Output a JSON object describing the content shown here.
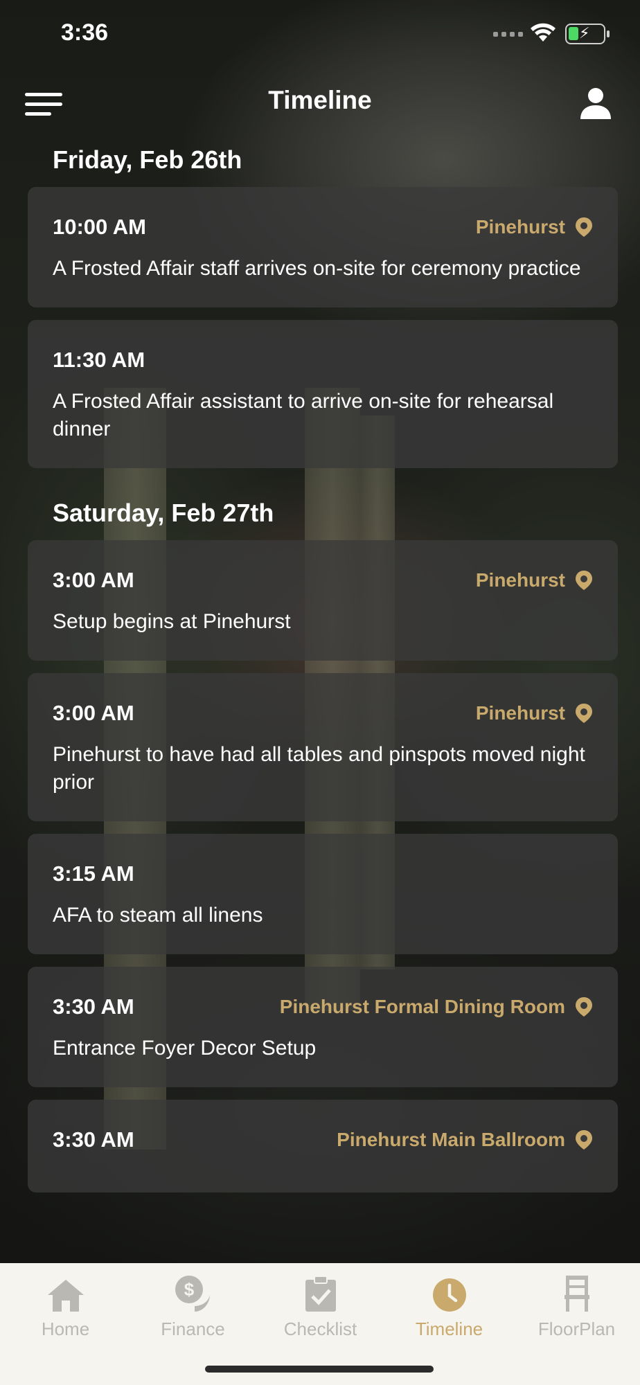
{
  "status_bar": {
    "time": "3:36"
  },
  "header": {
    "title": "Timeline"
  },
  "timeline": [
    {
      "day": "Friday, Feb 26th",
      "events": [
        {
          "time": "10:00 AM",
          "location": "Pinehurst",
          "description": "A Frosted Affair staff arrives on-site for ceremony practice"
        },
        {
          "time": "11:30 AM",
          "location": "",
          "description": "A Frosted Affair assistant to arrive on-site for rehearsal dinner"
        }
      ]
    },
    {
      "day": "Saturday, Feb 27th",
      "events": [
        {
          "time": "3:00 AM",
          "location": "Pinehurst",
          "description": "Setup begins at Pinehurst"
        },
        {
          "time": "3:00 AM",
          "location": "Pinehurst",
          "description": "Pinehurst to have had all tables and pinspots moved night prior"
        },
        {
          "time": "3:15 AM",
          "location": "",
          "description": "AFA to steam all linens"
        },
        {
          "time": "3:30 AM",
          "location": "Pinehurst Formal Dining Room",
          "description": "Entrance Foyer Decor Setup"
        },
        {
          "time": "3:30 AM",
          "location": "Pinehurst Main Ballroom",
          "description": ""
        }
      ]
    }
  ],
  "tabs": [
    {
      "label": "Home",
      "icon": "home-icon"
    },
    {
      "label": "Finance",
      "icon": "finance-icon"
    },
    {
      "label": "Checklist",
      "icon": "checklist-icon"
    },
    {
      "label": "Timeline",
      "icon": "clock-icon",
      "active": true
    },
    {
      "label": "FloorPlan",
      "icon": "chair-icon"
    }
  ],
  "colors": {
    "accent": "#c9a96c",
    "inactive": "#b9b8b2",
    "tab_bg": "#f6f4ee",
    "card_bg": "#3a3a3a"
  }
}
